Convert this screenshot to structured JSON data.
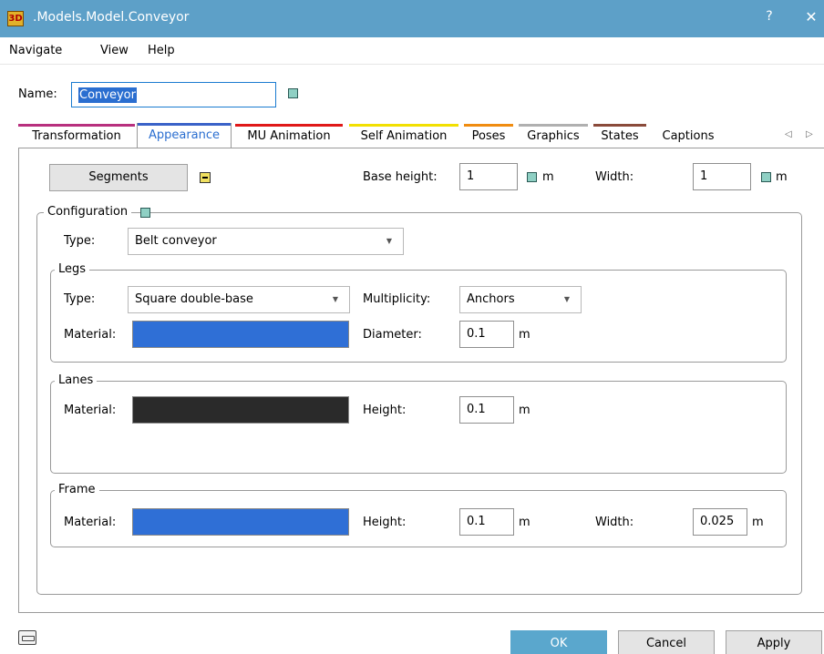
{
  "window": {
    "icon_text": "3D",
    "title": ".Models.Model.Conveyor",
    "help_label": "?",
    "close_label": "✕"
  },
  "menu": [
    "Navigate",
    "View",
    "Help"
  ],
  "name": {
    "label": "Name:",
    "value": "Conveyor"
  },
  "tabs": [
    {
      "label": "Transformation",
      "color": "#b8307e"
    },
    {
      "label": "Appearance",
      "color": "#3a62c8",
      "active": true
    },
    {
      "label": "MU Animation",
      "color": "#e01818"
    },
    {
      "label": "Self Animation",
      "color": "#f2e000"
    },
    {
      "label": "Poses",
      "color": "#f08c10"
    },
    {
      "label": "Graphics",
      "color": "#b0b0b0"
    },
    {
      "label": "States",
      "color": "#8a4a3a"
    },
    {
      "label": "Captions",
      "color": ""
    }
  ],
  "tab_nav": {
    "left": "◁",
    "right": "▷"
  },
  "appearance": {
    "segments_button": "Segments",
    "base_height": {
      "label": "Base height:",
      "value": "1",
      "unit": "m"
    },
    "width": {
      "label": "Width:",
      "value": "1",
      "unit": "m"
    },
    "configuration": {
      "title": "Configuration",
      "type_label": "Type:",
      "type_value": "Belt conveyor",
      "legs": {
        "title": "Legs",
        "type_label": "Type:",
        "type_value": "Square double-base",
        "multiplicity_label": "Multiplicity:",
        "multiplicity_value": "Anchors",
        "material_label": "Material:",
        "material_color": "#2f6fd6",
        "diameter_label": "Diameter:",
        "diameter_value": "0.1",
        "diameter_unit": "m"
      },
      "lanes": {
        "title": "Lanes",
        "material_label": "Material:",
        "material_color": "#2a2a2a",
        "height_label": "Height:",
        "height_value": "0.1",
        "height_unit": "m"
      },
      "frame": {
        "title": "Frame",
        "material_label": "Material:",
        "material_color": "#2f6fd6",
        "height_label": "Height:",
        "height_value": "0.1",
        "height_unit": "m",
        "width_label": "Width:",
        "width_value": "0.025",
        "width_unit": "m"
      }
    }
  },
  "footer": {
    "ok": "OK",
    "cancel": "Cancel",
    "apply": "Apply",
    "left_icon": "keyboard-icon"
  }
}
